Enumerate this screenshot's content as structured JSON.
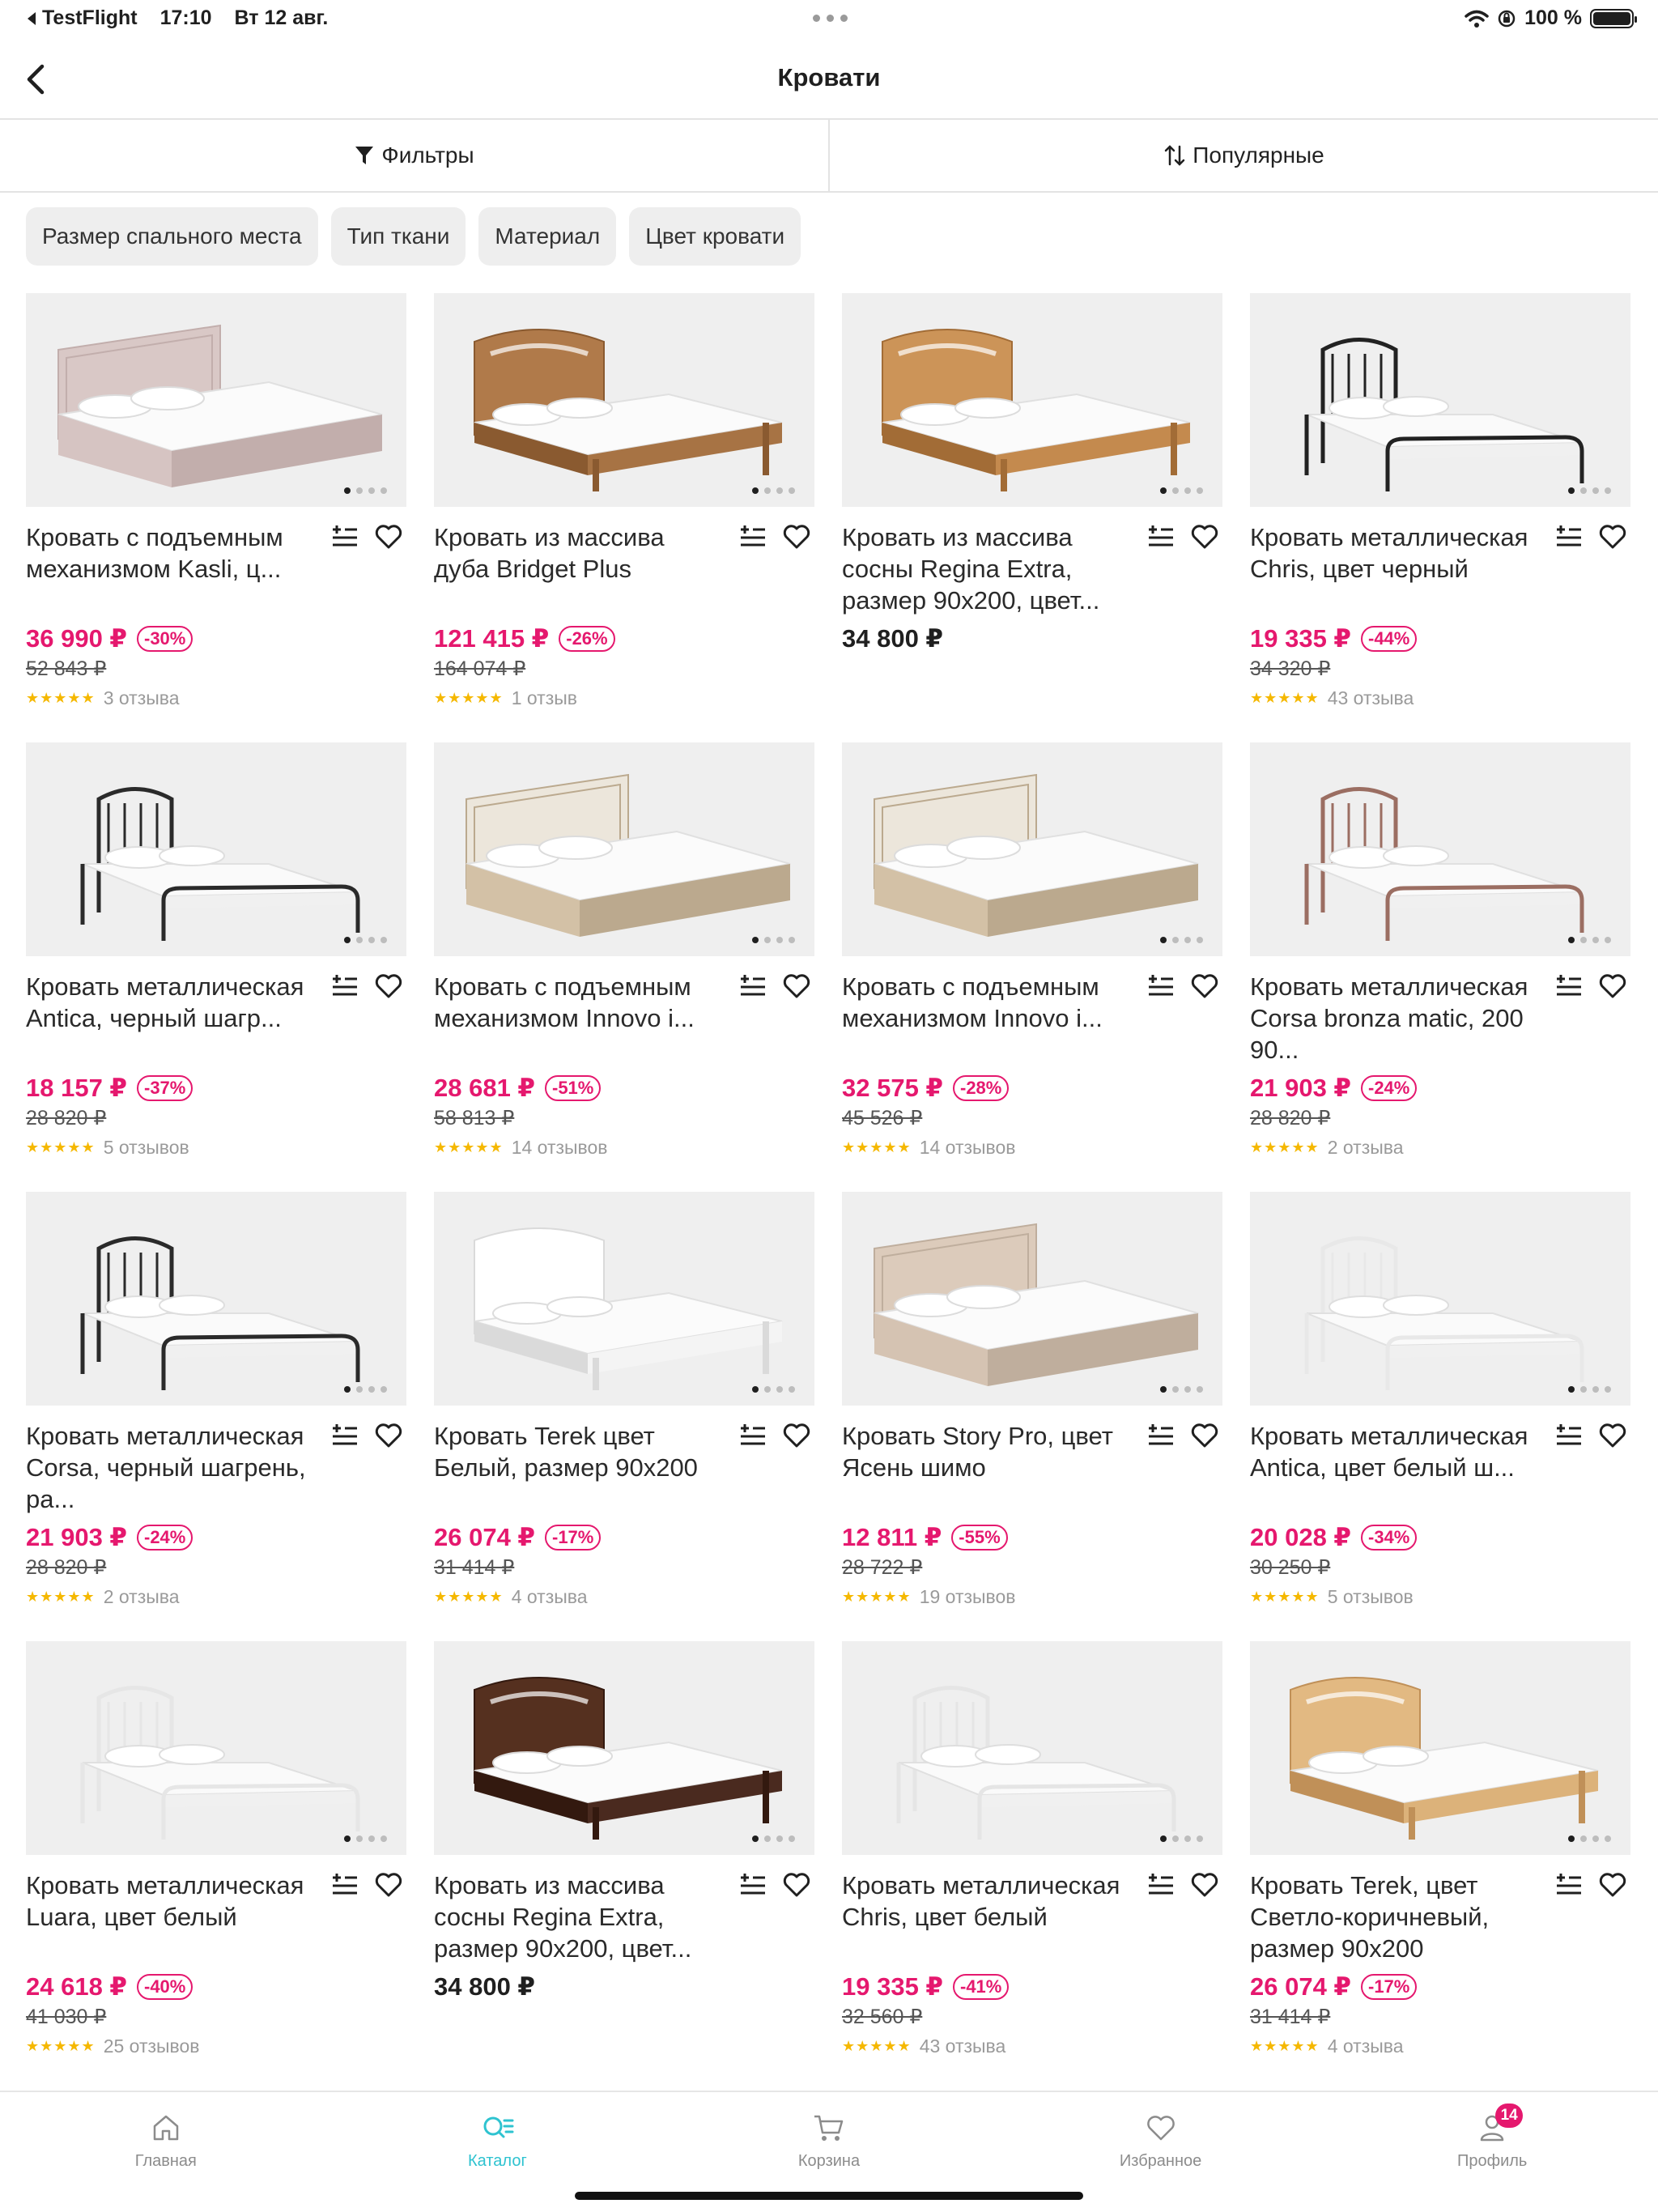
{
  "status_bar": {
    "app_back": "TestFlight",
    "time": "17:10",
    "date": "Вт 12 авг.",
    "battery": "100 %"
  },
  "header": {
    "title": "Кровати"
  },
  "toolbar": {
    "filters": "Фильтры",
    "sort": "Популярные"
  },
  "chips": [
    "Размер спального места",
    "Тип ткани",
    "Материал",
    "Цвет кровати"
  ],
  "products": [
    {
      "name": "Кровать с подъемным механизмом Kasli, ц...",
      "price": "36 990 ₽",
      "discount": "-30%",
      "old_price": "52 843 ₽",
      "reviews": "3 отзыва",
      "style": "pink-upholstered"
    },
    {
      "name": "Кровать из массива дуба Bridget Plus",
      "price": "121 415 ₽",
      "discount": "-26%",
      "old_price": "164 074 ₽",
      "reviews": "1 отзыв",
      "style": "oak-wood"
    },
    {
      "name": "Кровать из массива сосны Regina Extra, размер 90х200, цвет...",
      "price": "34 800 ₽",
      "discount": "",
      "old_price": "",
      "reviews": "",
      "style": "pine-wood"
    },
    {
      "name": "Кровать металлическая Chris, цвет черный",
      "price": "19 335 ₽",
      "discount": "-44%",
      "old_price": "34 320 ₽",
      "reviews": "43 отзыва",
      "style": "black-metal-square"
    },
    {
      "name": "Кровать металлическая Antica, черный шагр...",
      "price": "18 157 ₽",
      "discount": "-37%",
      "old_price": "28 820 ₽",
      "reviews": "5 отзывов",
      "style": "black-metal-round"
    },
    {
      "name": "Кровать с подъемным механизмом Innovo i...",
      "price": "28 681 ₽",
      "discount": "-51%",
      "old_price": "58 813 ₽",
      "reviews": "14 отзывов",
      "style": "sonoma-upholstered"
    },
    {
      "name": "Кровать с подъемным механизмом Innovo i...",
      "price": "32 575 ₽",
      "discount": "-28%",
      "old_price": "45 526 ₽",
      "reviews": "14 отзывов",
      "style": "sonoma-upholstered"
    },
    {
      "name": "Кровать металлическая Corsa bronza matic, 200 90...",
      "price": "21 903 ₽",
      "discount": "-24%",
      "old_price": "28 820 ₽",
      "reviews": "2 отзыва",
      "style": "bronze-metal"
    },
    {
      "name": "Кровать металлическая Corsa, черный шагрень, ра...",
      "price": "21 903 ₽",
      "discount": "-24%",
      "old_price": "28 820 ₽",
      "reviews": "2 отзыва",
      "style": "black-metal-arch"
    },
    {
      "name": "Кровать Terek цвет Белый, размер 90х200",
      "price": "26 074 ₽",
      "discount": "-17%",
      "old_price": "31 414 ₽",
      "reviews": "4 отзыва",
      "style": "white-wood"
    },
    {
      "name": "Кровать Story Pro, цвет Ясень шимо",
      "price": "12 811 ₽",
      "discount": "-55%",
      "old_price": "28 722 ₽",
      "reviews": "19 отзывов",
      "style": "ash-panel"
    },
    {
      "name": "Кровать металлическая Antica, цвет белый ш...",
      "price": "20 028 ₽",
      "discount": "-34%",
      "old_price": "30 250 ₽",
      "reviews": "5 отзывов",
      "style": "white-metal"
    },
    {
      "name": "Кровать металлическая Luara, цвет белый",
      "price": "24 618 ₽",
      "discount": "-40%",
      "old_price": "41 030 ₽",
      "reviews": "25 отзывов",
      "style": "white-metal-ornate"
    },
    {
      "name": "Кровать из массива сосны Regina Extra, размер 90х200, цвет...",
      "price": "34 800 ₽",
      "discount": "",
      "old_price": "",
      "reviews": "",
      "style": "dark-wood"
    },
    {
      "name": "Кровать металлическая Chris, цвет белый",
      "price": "19 335 ₽",
      "discount": "-41%",
      "old_price": "32 560 ₽",
      "reviews": "43 отзыва",
      "style": "white-metal-square"
    },
    {
      "name": "Кровать Terek, цвет Светло-коричневый, размер 90х200",
      "price": "26 074 ₽",
      "discount": "-17%",
      "old_price": "31 414 ₽",
      "reviews": "4 отзыва",
      "style": "light-wood"
    }
  ],
  "tabs": [
    {
      "label": "Главная",
      "icon": "home-icon"
    },
    {
      "label": "Каталог",
      "icon": "catalog-icon",
      "active": true
    },
    {
      "label": "Корзина",
      "icon": "cart-icon"
    },
    {
      "label": "Избранное",
      "icon": "heart-icon"
    },
    {
      "label": "Профиль",
      "icon": "profile-icon",
      "badge": "14"
    }
  ],
  "colors": {
    "accent": "#e5186e",
    "active_tab": "#2ec3d0",
    "stars": "#f5b800"
  }
}
